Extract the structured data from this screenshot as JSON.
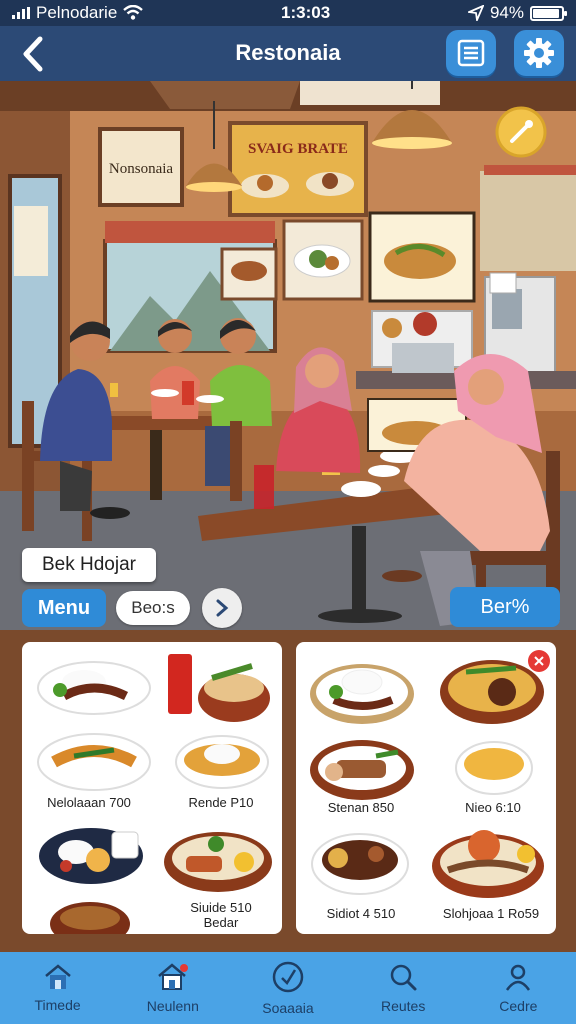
{
  "status_bar": {
    "carrier": "Pelnodarie",
    "time": "1:3:03",
    "battery": "94%",
    "battery_level": 0.94
  },
  "header": {
    "back_icon": "chevron-left-icon",
    "title": "Restonaia",
    "menu_icon": "list-icon",
    "settings_icon": "gear-icon"
  },
  "scene": {
    "shop_sign": "Nonsonaia",
    "board_title": "SVAIG BRATE",
    "sticker": "Bek Hdojar",
    "menu_button": "Menu",
    "secondary_button": "Beo:s",
    "next_icon": "chevron-right-icon",
    "cta_button": "Ber%",
    "tool_icon": "wrench-icon"
  },
  "cards": {
    "left": [
      {
        "caption": "Nelolaaan 700"
      },
      {
        "caption": "Rende P10"
      },
      {
        "caption": "Siuide 510\nBedar"
      }
    ],
    "right": [
      {
        "caption": "Stenan 850"
      },
      {
        "caption": "Nieo 6:10"
      },
      {
        "caption": "Sidiot 4 510"
      },
      {
        "caption": "Slohjoaa 1 Ro59"
      }
    ],
    "close_icon": "close-icon"
  },
  "tabbar": [
    {
      "label": "Timede",
      "icon": "home-icon"
    },
    {
      "label": "Neulenn",
      "icon": "house-badge-icon"
    },
    {
      "label": "Soaaaia",
      "icon": "clock-icon"
    },
    {
      "label": "Reutes",
      "icon": "search-icon"
    },
    {
      "label": "Cedre",
      "icon": "profile-icon"
    }
  ],
  "colors": {
    "header": "#2c4a76",
    "accent": "#2f8bd7",
    "tabbar": "#4aa3e6",
    "frame": "#7a4a2c"
  }
}
